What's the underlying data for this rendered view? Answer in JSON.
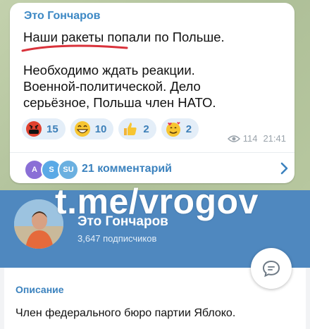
{
  "post": {
    "sender": "Это Гончаров",
    "line1": "Наши ракеты попали по Польше.",
    "line2": "Необходимо ждать реакции.\nВоенной-политической. Дело\nсерьёзное, Польша член НАТО.",
    "reactions": [
      {
        "emoji": "angry-face-icon",
        "count": "15"
      },
      {
        "emoji": "grin-face-icon",
        "count": "10"
      },
      {
        "emoji": "thumbs-up-icon",
        "count": "2"
      },
      {
        "emoji": "smiling-hearts-face-icon",
        "count": "2"
      }
    ],
    "views": "114",
    "time": "21:41",
    "commenters": [
      {
        "initial": "A",
        "color": "#8a6fd6"
      },
      {
        "initial": "S",
        "color": "#5aa9e6"
      },
      {
        "initial": "SU",
        "color": "#6bb0e0"
      }
    ],
    "comments_label": "21 комментарий"
  },
  "watermark": "t.me/vrogov",
  "channel": {
    "name": "Это Гончаров",
    "subscribers": "3,647 подписчиков",
    "description_label": "Описание",
    "description": "Член федерального бюро партии Яблоко."
  },
  "colors": {
    "accent": "#3b82be",
    "header_blue": "#4f88bf",
    "underline_red": "#d9323b"
  }
}
